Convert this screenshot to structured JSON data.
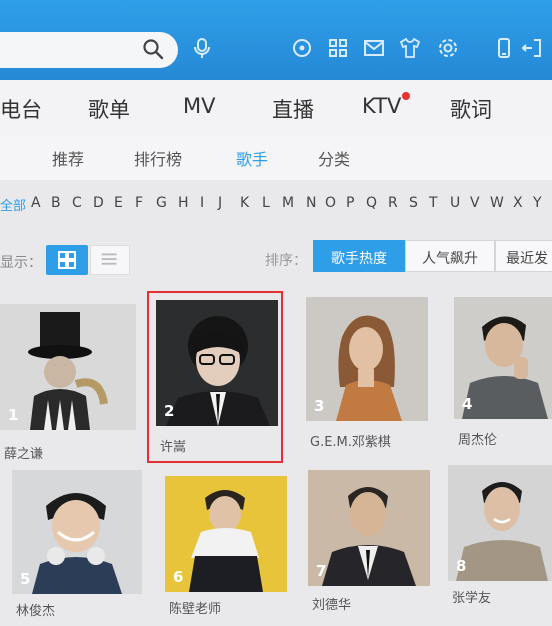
{
  "colors": {
    "accent": "#2f9ee8",
    "highlight": "#e43030",
    "dot": "#e8322d"
  },
  "toolbar_icons": [
    "search-icon",
    "mic-icon",
    "target-icon",
    "apps-icon",
    "mail-icon",
    "shirt-icon",
    "gear-icon",
    "phone-icon",
    "logout-icon"
  ],
  "mainnav": {
    "radio": "电台",
    "playlist": "歌单",
    "mv": "MV",
    "live": "直播",
    "ktv": "KTV",
    "lyrics": "歌词"
  },
  "subnav": {
    "recommend": "推荐",
    "charts": "排行榜",
    "singers": "歌手",
    "category": "分类"
  },
  "alphabet": {
    "all": "全部",
    "letters": [
      "A",
      "B",
      "C",
      "D",
      "E",
      "F",
      "G",
      "H",
      "I",
      "J",
      "K",
      "L",
      "M",
      "N",
      "O",
      "P",
      "Q",
      "R",
      "S",
      "T",
      "U",
      "V",
      "W",
      "X",
      "Y"
    ]
  },
  "display": {
    "label": "显示："
  },
  "sort": {
    "label": "排序：",
    "hot": "歌手热度",
    "rising": "人气飙升",
    "recent": "最近发"
  },
  "artists": [
    {
      "rank": "1",
      "name": "薛之谦"
    },
    {
      "rank": "2",
      "name": "许嵩"
    },
    {
      "rank": "3",
      "name": "G.E.M.邓紫棋"
    },
    {
      "rank": "4",
      "name": "周杰伦"
    },
    {
      "rank": "5",
      "name": "林俊杰"
    },
    {
      "rank": "6",
      "name": "陈壁老师"
    },
    {
      "rank": "7",
      "name": "刘德华"
    },
    {
      "rank": "8",
      "name": "张学友"
    }
  ]
}
